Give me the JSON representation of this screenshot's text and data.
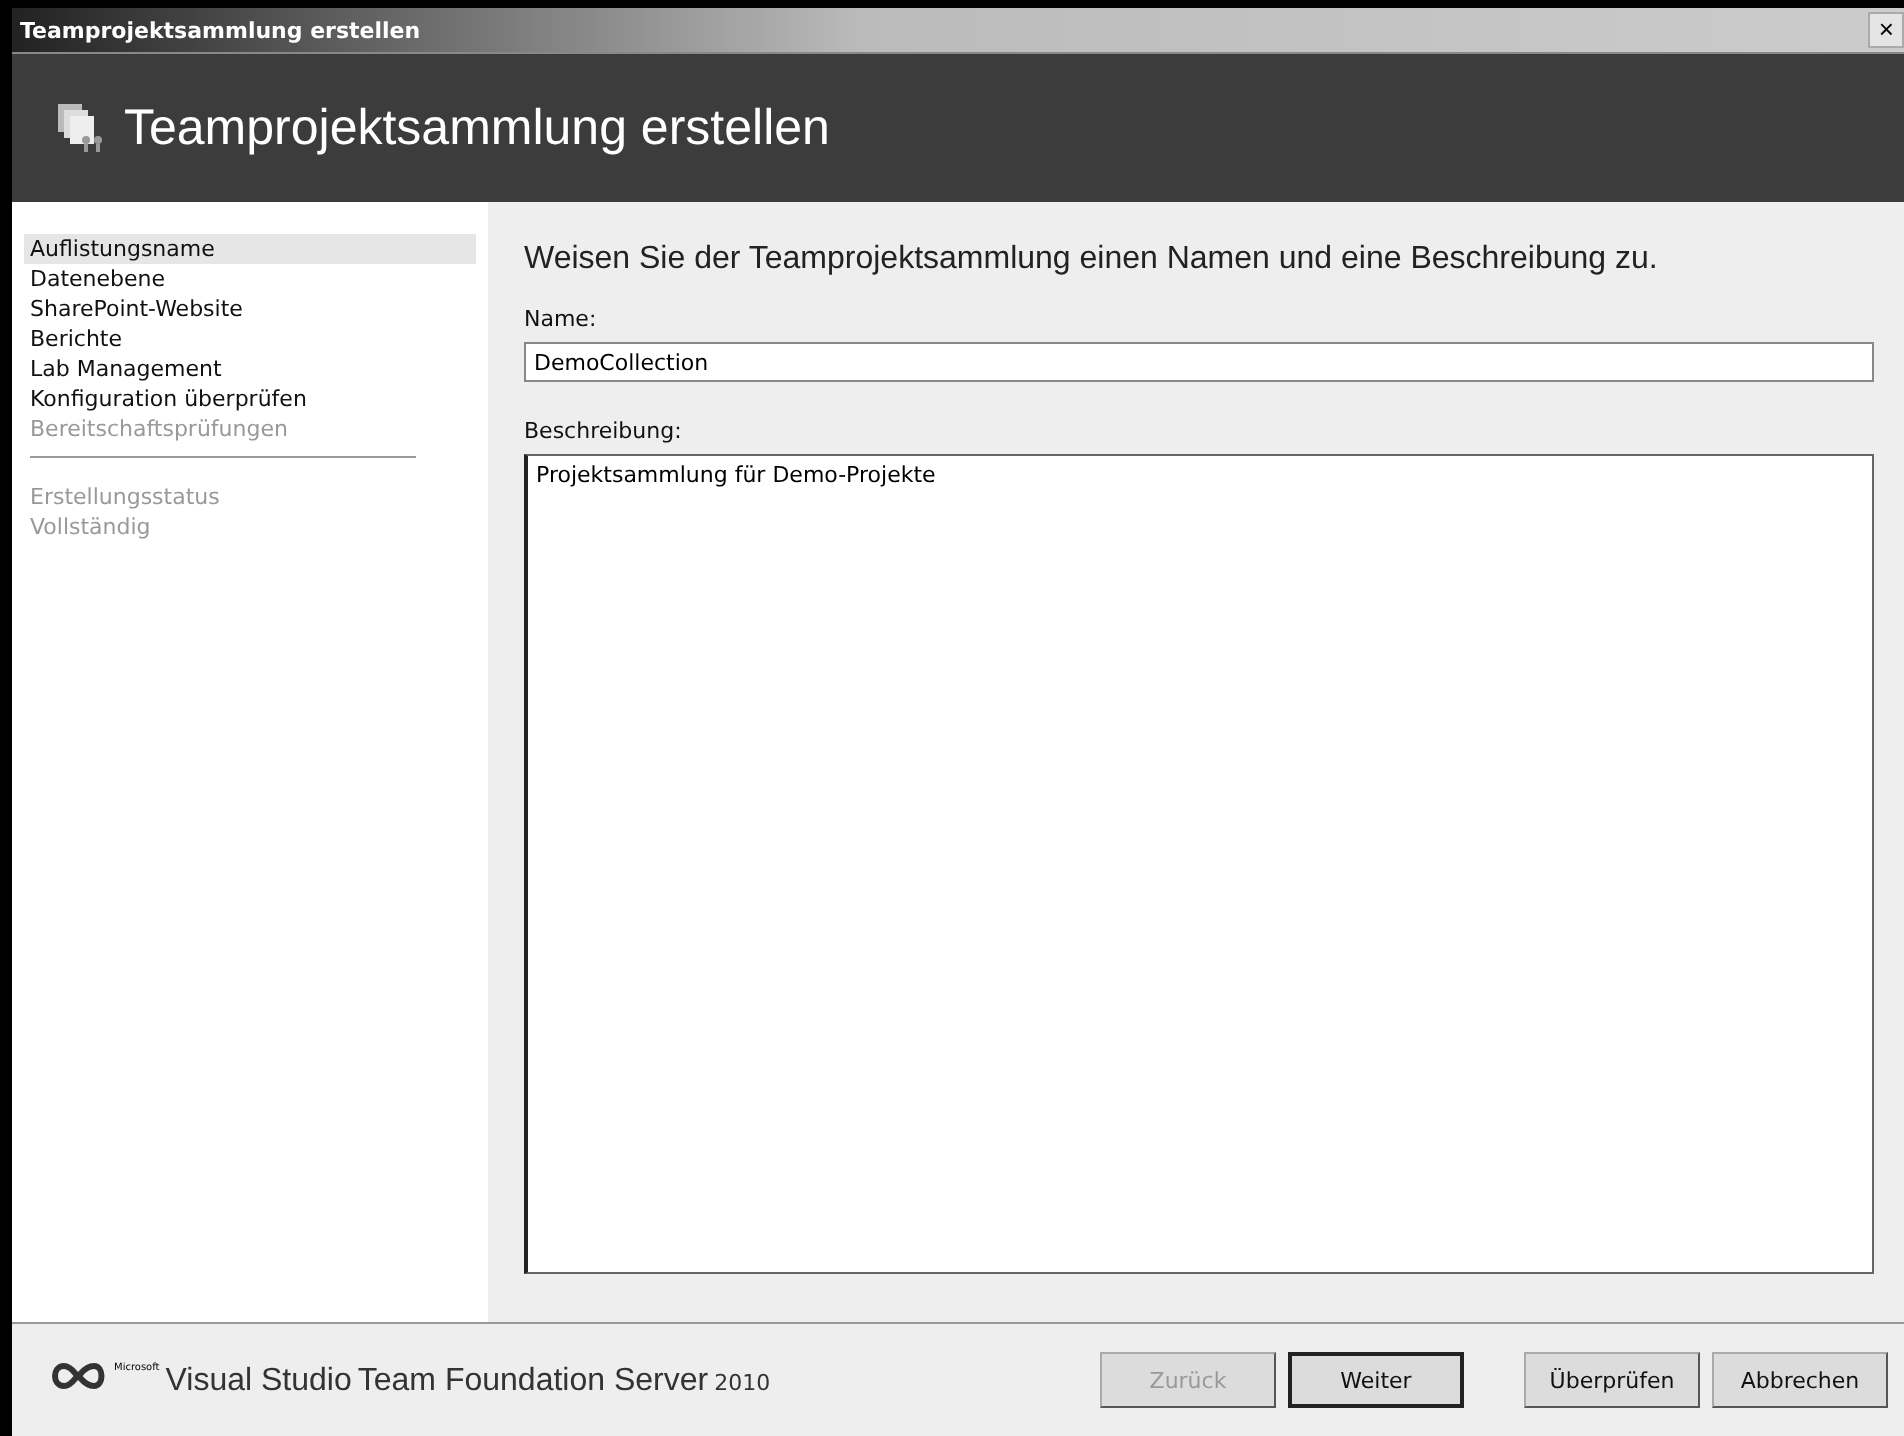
{
  "window": {
    "title": "Teamprojektsammlung erstellen",
    "close": "×"
  },
  "header": {
    "title": "Teamprojektsammlung erstellen"
  },
  "sidebar": {
    "sections": [
      {
        "items": [
          {
            "label": "Auflistungsname",
            "selected": true,
            "disabled": false
          },
          {
            "label": "Datenebene",
            "selected": false,
            "disabled": false
          },
          {
            "label": "SharePoint-Website",
            "selected": false,
            "disabled": false
          },
          {
            "label": "Berichte",
            "selected": false,
            "disabled": false
          },
          {
            "label": "Lab Management",
            "selected": false,
            "disabled": false
          },
          {
            "label": "Konfiguration überprüfen",
            "selected": false,
            "disabled": false
          },
          {
            "label": "Bereitschaftsprüfungen",
            "selected": false,
            "disabled": true
          }
        ]
      },
      {
        "items": [
          {
            "label": "Erstellungsstatus",
            "selected": false,
            "disabled": true
          },
          {
            "label": "Vollständig",
            "selected": false,
            "disabled": true
          }
        ]
      }
    ]
  },
  "content": {
    "heading": "Weisen Sie der Teamprojektsammlung einen Namen und eine Beschreibung zu.",
    "name_label": "Name:",
    "name_value": "DemoCollection",
    "description_label": "Beschreibung:",
    "description_value": "Projektsammlung für Demo-Projekte"
  },
  "footer": {
    "logo": {
      "maker": "Microsoft",
      "product": "Visual Studio",
      "name": "Team Foundation Server",
      "year": "2010"
    },
    "buttons": [
      {
        "label": "Zurück",
        "disabled": true,
        "default": false
      },
      {
        "label": "Weiter",
        "disabled": false,
        "default": true
      },
      {
        "label": "Überprüfen",
        "disabled": false,
        "default": false
      },
      {
        "label": "Abbrechen",
        "disabled": false,
        "default": false
      }
    ]
  }
}
